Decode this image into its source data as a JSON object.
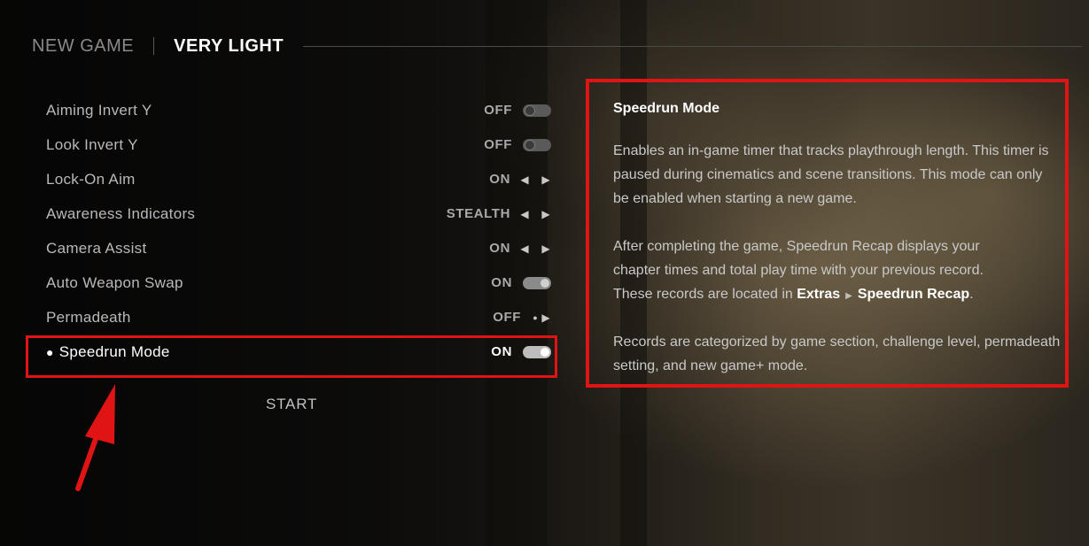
{
  "header": {
    "primary": "NEW GAME",
    "secondary": "VERY LIGHT"
  },
  "settings": [
    {
      "label": "Aiming Invert Y",
      "value": "OFF",
      "control": "toggle",
      "state": "off"
    },
    {
      "label": "Look Invert Y",
      "value": "OFF",
      "control": "toggle",
      "state": "off"
    },
    {
      "label": "Lock-On Aim",
      "value": "ON",
      "control": "arrows"
    },
    {
      "label": "Awareness Indicators",
      "value": "STEALTH",
      "control": "arrows"
    },
    {
      "label": "Camera Assist",
      "value": "ON",
      "control": "arrows"
    },
    {
      "label": "Auto Weapon Swap",
      "value": "ON",
      "control": "toggle",
      "state": "on"
    },
    {
      "label": "Permadeath",
      "value": "OFF",
      "control": "dot-arrow"
    },
    {
      "label": "Speedrun Mode",
      "value": "ON",
      "control": "toggle",
      "state": "on",
      "selected": true
    }
  ],
  "start_label": "START",
  "description": {
    "title": "Speedrun Mode",
    "para1": "Enables an in-game timer that tracks playthrough length. This timer is paused during cinematics and scene transitions. This mode can only be enabled when starting a new game.",
    "para2_line1": "After completing the game, Speedrun Recap displays your",
    "para2_line2": "chapter times and total play time with your previous record.",
    "para2_line3_prefix": "These records are located in",
    "link_a": "Extras",
    "link_b": "Speedrun Recap",
    "para2_line3_suffix": ".",
    "para3": "Records are categorized by game section, challenge level, permadeath setting, and new game+ mode."
  },
  "colors": {
    "annotation_red": "#e01414"
  },
  "icons": {
    "arrow_left": "arrow-left-icon",
    "arrow_right": "arrow-right-icon",
    "toggle": "toggle-switch",
    "annotation": "annotation-arrow"
  }
}
